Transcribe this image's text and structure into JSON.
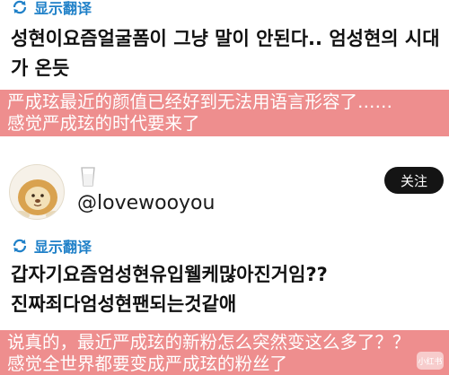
{
  "post1": {
    "translate_label": "显示翻译",
    "korean_line1": "성현이요즘얼굴폼이 그냥 말이 안된다.. 엄성현의 시대",
    "korean_line2": "가 온듯",
    "chinese_line1": "严成玹最近的颜值已经好到无法用语言形容了……",
    "chinese_line2": "感觉严成玹的时代要来了"
  },
  "post2": {
    "username": "@lovewooyou",
    "follow_label": "关注",
    "translate_label": "显示翻译",
    "korean_line1": "갑자기요즘엄성현유입웰케많아진거임??",
    "korean_line2": "진짜죄다엄성현팬되는것같애",
    "chinese_line1": "说真的，最近严成玹的新粉怎么突然变这么多了？？",
    "chinese_line2": "感觉全世界都要变成严成玹的粉丝了"
  },
  "watermark": "小红书",
  "colors": {
    "translate_blue": "#1f80c8",
    "highlight_red": "#ee8e8e",
    "follow_button": "#141414"
  },
  "icons": [
    "translate-icon",
    "milk-glass-icon",
    "lion-avatar"
  ]
}
